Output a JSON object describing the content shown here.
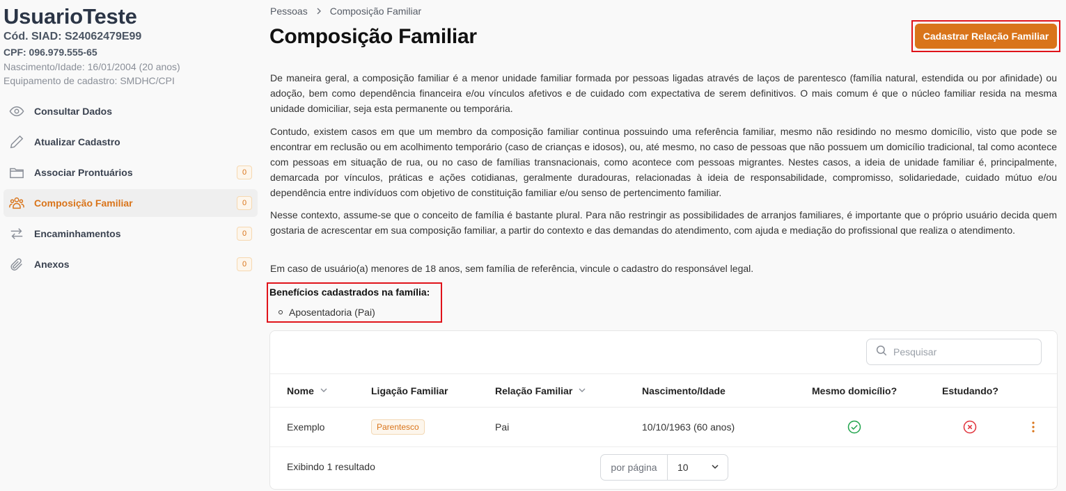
{
  "user": {
    "name": "UsuarioTeste",
    "siad": "Cód. SIAD: S24062479E99",
    "cpf": "CPF: 096.979.555-65",
    "birth": "Nascimento/Idade: 16/01/2004 (20 anos)",
    "equipment": "Equipamento de cadastro: SMDHC/CPI"
  },
  "sidebar": {
    "items": [
      {
        "label": "Consultar Dados",
        "icon": "eye-icon"
      },
      {
        "label": "Atualizar Cadastro",
        "icon": "pencil-icon"
      },
      {
        "label": "Associar Prontuários",
        "icon": "folder-icon",
        "badge": "0"
      },
      {
        "label": "Composição Familiar",
        "icon": "users-icon",
        "badge": "0",
        "active": true
      },
      {
        "label": "Encaminhamentos",
        "icon": "arrows-swap-icon",
        "badge": "0"
      },
      {
        "label": "Anexos",
        "icon": "paperclip-icon",
        "badge": "0"
      }
    ]
  },
  "breadcrumb": {
    "root": "Pessoas",
    "current": "Composição Familiar"
  },
  "page": {
    "title": "Composição Familiar",
    "primary_button": "Cadastrar Relação Familiar",
    "paragraphs": [
      "De maneira geral, a composição familiar é a menor unidade familiar formada por pessoas ligadas através de laços de parentesco (família natural, estendida ou por afinidade) ou adoção, bem como dependência financeira e/ou vínculos afetivos e de cuidado com expectativa de serem definitivos. O mais comum é que o núcleo familiar resida na mesma unidade domiciliar, seja esta permanente ou temporária.",
      "Contudo, existem casos em que um membro da composição familiar continua possuindo uma referência familiar, mesmo não residindo no mesmo domicílio, visto que pode se encontrar em reclusão ou em acolhimento temporário (caso de crianças e idosos), ou, até mesmo, no caso de pessoas que não possuem um domicílio tradicional, tal como acontece com pessoas em situação de rua, ou no caso de famílias transnacionais, como acontece com pessoas migrantes. Nestes casos, a ideia de unidade familiar é, principalmente, demarcada por vínculos, práticas e ações cotidianas, geralmente duradouras, relacionadas à ideia de responsabilidade, compromisso, solidariedade, cuidado mútuo e/ou dependência entre indivíduos com objetivo de constituição familiar e/ou senso de pertencimento familiar.",
      "Nesse contexto, assume-se que o conceito de família é bastante plural. Para não restringir as possibilidades de arranjos familiares, é importante que o próprio usuário decida quem gostaria de acrescentar em sua composição familiar, a partir do contexto e das demandas do atendimento, com ajuda e mediação do profissional que realiza o atendimento.",
      "Em caso de usuário(a) menores de 18 anos, sem família de referência, vincule o cadastro do responsável legal."
    ],
    "benefits_title": "Benefícios cadastrados na família:",
    "benefits": [
      "Aposentadoria (Pai)"
    ]
  },
  "table": {
    "search_placeholder": "Pesquisar",
    "columns": [
      "Nome",
      "Ligação Familiar",
      "Relação Familiar",
      "Nascimento/Idade",
      "Mesmo domicílio?",
      "Estudando?"
    ],
    "rows": [
      {
        "nome": "Exemplo",
        "ligacao": "Parentesco",
        "relacao": "Pai",
        "nascimento": "10/10/1963 (60 anos)",
        "mesmo_domicilio": true,
        "estudando": false
      }
    ],
    "footer": "Exibindo 1 resultado",
    "per_page_label": "por página",
    "per_page_value": "10"
  },
  "colors": {
    "accent": "#d9741a",
    "highlight": "#e0131a",
    "success": "#1ea34a",
    "danger": "#e0313a"
  }
}
